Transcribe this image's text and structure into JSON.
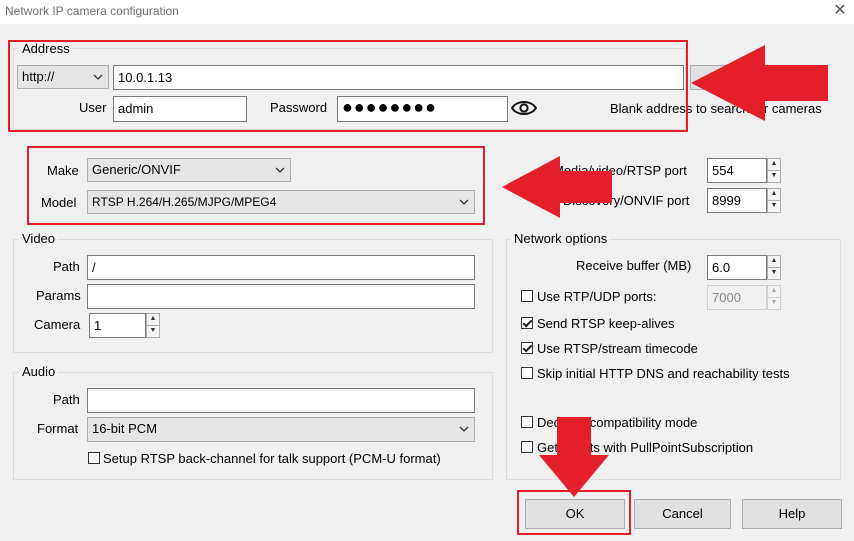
{
  "window": {
    "title": "Network IP camera configuration"
  },
  "address": {
    "group_label": "Address",
    "scheme": "http://",
    "host": "10.0.1.13",
    "user_label": "User",
    "user": "admin",
    "password_label": "Password",
    "password_masked": "●●●●●●●●",
    "hint": "Blank address to search for cameras"
  },
  "device": {
    "make_label": "Make",
    "make": "Generic/ONVIF",
    "model_label": "Model",
    "model": "RTSP H.264/H.265/MJPG/MPEG4",
    "media_port_label": "Media/video/RTSP port",
    "media_port": "554",
    "discovery_port_label": "Discovery/ONVIF port",
    "discovery_port": "8999"
  },
  "video": {
    "group_label": "Video",
    "path_label": "Path",
    "path": "/",
    "params_label": "Params",
    "params": "",
    "camera_label": "Camera",
    "camera": "1"
  },
  "audio": {
    "group_label": "Audio",
    "path_label": "Path",
    "path": "",
    "format_label": "Format",
    "format": "16-bit PCM",
    "backchannel_label": "Setup RTSP back-channel for talk support (PCM-U format)"
  },
  "network": {
    "group_label": "Network options",
    "receive_buffer_label": "Receive buffer (MB)",
    "receive_buffer": "6.0",
    "rtp_udp_label": "Use RTP/UDP ports:",
    "rtp_udp_port": "7000",
    "keepalive_label": "Send RTSP keep-alives",
    "timecode_label": "Use RTSP/stream timecode",
    "skip_dns_label": "Skip initial HTTP DNS and reachability tests",
    "decoder_compat_label": "Decoder compatibility mode",
    "events_label": "Get events with PullPointSubscription"
  },
  "buttons": {
    "ok": "OK",
    "cancel": "Cancel",
    "help": "Help"
  },
  "colors": {
    "annotation_red": "#e41e2a"
  }
}
